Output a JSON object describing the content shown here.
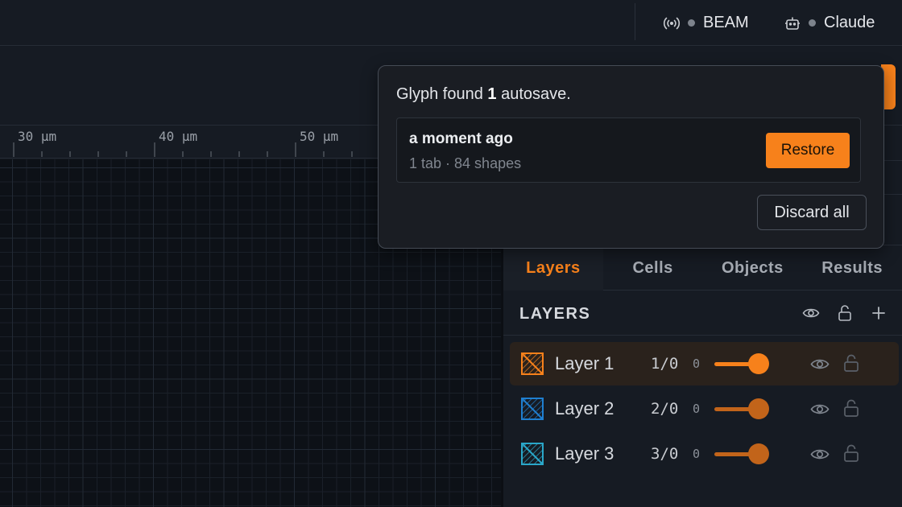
{
  "status_bar": {
    "items": [
      {
        "label": "BEAM",
        "icon": "broadcast-icon"
      },
      {
        "label": "Claude",
        "icon": "robot-icon"
      }
    ]
  },
  "ruler": {
    "labels": [
      "30 µm",
      "40 µm",
      "50 µm"
    ]
  },
  "autosave_popup": {
    "message_prefix": "Glyph found",
    "count": "1",
    "message_suffix": "autosave.",
    "entry": {
      "time": "a moment ago",
      "meta": "1 tab · 84 shapes"
    },
    "restore_label": "Restore",
    "discard_label": "Discard all"
  },
  "panel": {
    "tabs": [
      {
        "label": "Layers",
        "active": true
      },
      {
        "label": "Cells",
        "active": false
      },
      {
        "label": "Objects",
        "active": false
      },
      {
        "label": "Results",
        "active": false
      }
    ],
    "layers_title": "LAYERS",
    "header_icons": [
      "eye-icon",
      "unlock-icon",
      "plus-icon"
    ],
    "layers": [
      {
        "name": "Layer 1",
        "number": "1/0",
        "datatype": "0",
        "opacity": 1.0,
        "color": "#f7811b",
        "active": true
      },
      {
        "name": "Layer 2",
        "number": "2/0",
        "datatype": "0",
        "opacity": 1.0,
        "color": "#1f7fd0",
        "active": false
      },
      {
        "name": "Layer 3",
        "number": "3/0",
        "datatype": "0",
        "opacity": 1.0,
        "color": "#2aa7c9",
        "active": false
      }
    ]
  },
  "colors": {
    "accent": "#f7811b",
    "background": "#161b23",
    "canvas": "#0d1117"
  }
}
